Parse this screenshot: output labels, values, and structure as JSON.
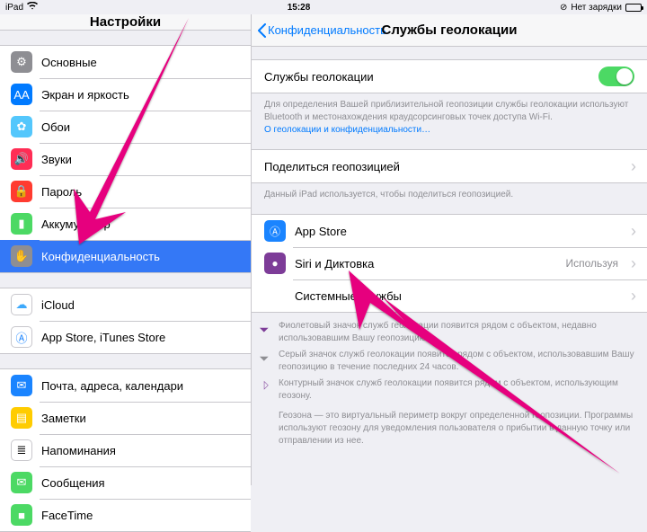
{
  "statusbar": {
    "device": "iPad",
    "time": "15:28",
    "charging": "Нет зарядки"
  },
  "sidebar": {
    "title": "Настройки",
    "groups": [
      {
        "items": [
          {
            "id": "general",
            "label": "Основные",
            "icon_bg": "#8e8e93",
            "glyph": "⚙"
          },
          {
            "id": "display",
            "label": "Экран и яркость",
            "icon_bg": "#007aff",
            "glyph": "AA"
          },
          {
            "id": "wallpaper",
            "label": "Обои",
            "icon_bg": "#54c7fc",
            "glyph": "✿"
          },
          {
            "id": "sounds",
            "label": "Звуки",
            "icon_bg": "#ff2d55",
            "glyph": "🔊"
          },
          {
            "id": "passcode",
            "label": "Пароль",
            "icon_bg": "#ff3b30",
            "glyph": "🔒"
          },
          {
            "id": "battery",
            "label": "Аккумулятор",
            "icon_bg": "#4cd964",
            "glyph": "▮"
          },
          {
            "id": "privacy",
            "label": "Конфиденциальность",
            "icon_bg": "#8e8e93",
            "glyph": "✋",
            "selected": true
          }
        ]
      },
      {
        "items": [
          {
            "id": "icloud",
            "label": "iCloud",
            "icon_bg": "#ffffff",
            "glyph": "☁",
            "glyph_color": "#3da9fc",
            "border": true
          },
          {
            "id": "appstore",
            "label": "App Store, iTunes Store",
            "icon_bg": "#ffffff",
            "glyph": "Ⓐ",
            "glyph_color": "#1a84ff",
            "border": true
          }
        ]
      },
      {
        "items": [
          {
            "id": "mail",
            "label": "Почта, адреса, календари",
            "icon_bg": "#1a84ff",
            "glyph": "✉"
          },
          {
            "id": "notes",
            "label": "Заметки",
            "icon_bg": "#ffcc00",
            "glyph": "▤"
          },
          {
            "id": "reminders",
            "label": "Напоминания",
            "icon_bg": "#ffffff",
            "glyph": "≣",
            "glyph_color": "#000",
            "border": true
          },
          {
            "id": "messages",
            "label": "Сообщения",
            "icon_bg": "#4cd964",
            "glyph": "✉"
          },
          {
            "id": "facetime",
            "label": "FaceTime",
            "icon_bg": "#4cd964",
            "glyph": "■"
          }
        ]
      }
    ]
  },
  "detail": {
    "back_label": "Конфиденциальность",
    "title": "Службы геолокации",
    "location_toggle": {
      "label": "Службы геолокации",
      "on": true
    },
    "location_footer": "Для определения Вашей приблизительной геопозиции службы геолокации используют Bluetooth и местонахождения краудсорсинговых точек доступа Wi-Fi.",
    "location_link": "О геолокации и конфиденциальности…",
    "share": {
      "label": "Поделиться геопозицией"
    },
    "share_footer": "Данный iPad используется, чтобы поделиться геопозицией.",
    "apps": [
      {
        "id": "appstore",
        "label": "App Store",
        "icon_bg": "#1a84ff",
        "glyph": "Ⓐ"
      },
      {
        "id": "siri",
        "label": "Siri и Диктовка",
        "icon_bg": "#7d3c98",
        "glyph": "●",
        "value": "Используя"
      },
      {
        "id": "system",
        "label": "Системные службы",
        "no_icon": true
      }
    ],
    "legend": [
      {
        "style": "purple",
        "text": "Фиолетовый значок служб геолокации появится рядом с объектом, недавно использовавшим Вашу геопозицию."
      },
      {
        "style": "grey",
        "text": "Серый значок служб геолокации появится рядом с объектом, использовавшим Вашу геопозицию в течение последних 24 часов."
      },
      {
        "style": "outline",
        "text": "Контурный значок служб геолокации появится рядом с объектом, использующим геозону."
      }
    ],
    "geofence_note": "Геозона — это виртуальный периметр вокруг определенной геопозиции. Программы используют геозону для уведомления пользователя о прибытии в данную точку или отправлении из нее."
  }
}
